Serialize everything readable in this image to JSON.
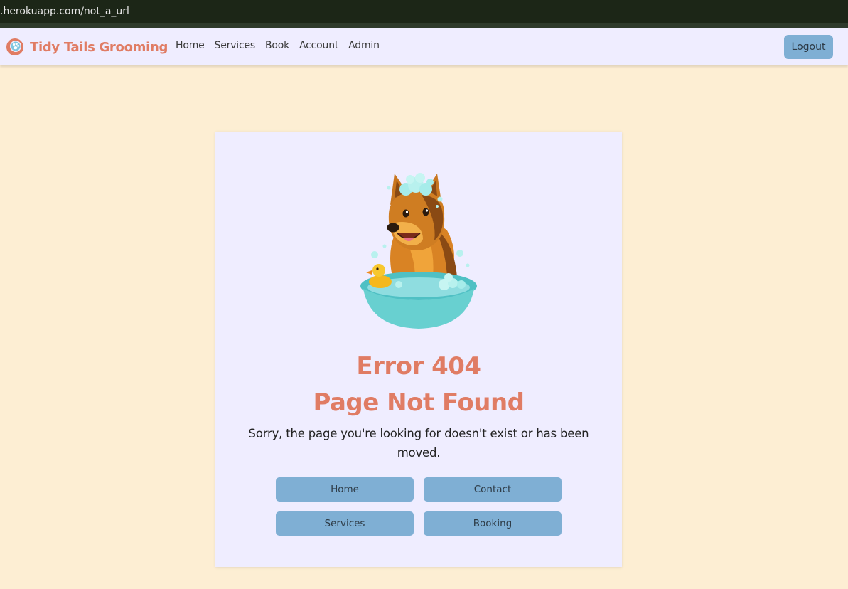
{
  "browser": {
    "url": ".herokuapp.com/not_a_url"
  },
  "navbar": {
    "brand_name": "Tidy Tails Grooming",
    "links": [
      "Home",
      "Services",
      "Book",
      "Account",
      "Admin"
    ],
    "logout_label": "Logout"
  },
  "error": {
    "code_line": "Error 404",
    "title_line": "Page Not Found",
    "message": "Sorry, the page you're looking for doesn't exist or has been moved."
  },
  "buttons": {
    "home": "Home",
    "contact": "Contact",
    "services": "Services",
    "booking": "Booking"
  },
  "colors": {
    "page_background": "#fdeed3",
    "card_background": "#efedff",
    "accent": "#e07c64",
    "button": "#7fafd4"
  }
}
